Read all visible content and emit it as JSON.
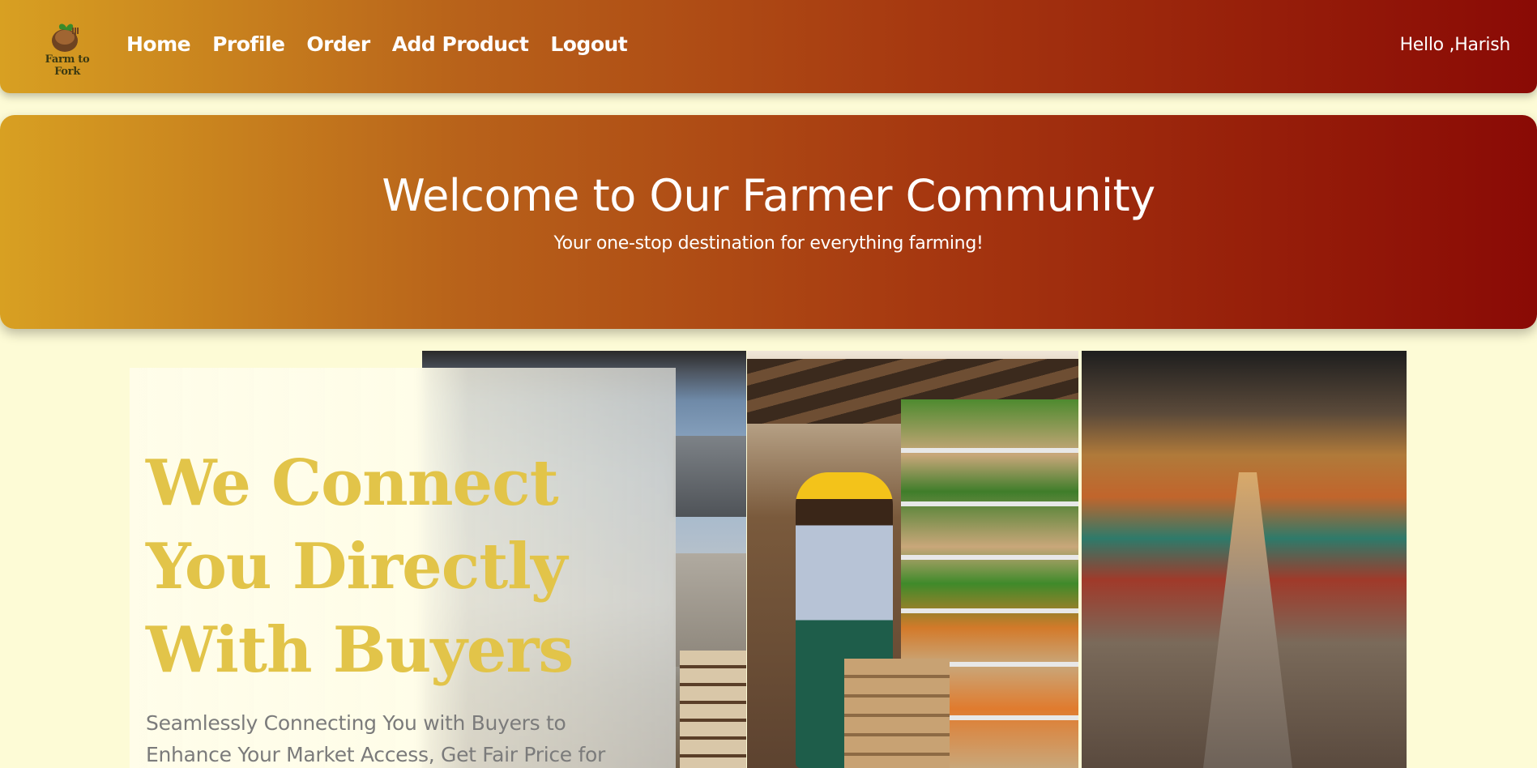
{
  "navbar": {
    "logo_text": "Farm to Fork",
    "links": [
      "Home",
      "Profile",
      "Order",
      "Add Product",
      "Logout"
    ],
    "greeting": "Hello ,Harish"
  },
  "hero": {
    "title": "Welcome to Our Farmer Community",
    "subtitle": "Your one-stop destination for everything farming!"
  },
  "feature": {
    "headline": "We Connect You Directly With Buyers",
    "description": "Seamlessly Connecting You with Buyers to Enhance Your Market Access, Get Fair Price for"
  },
  "colors": {
    "gradient_start": "#d8a022",
    "gradient_end": "#8a0a05",
    "page_background": "#fdfbd6",
    "headline": "#e2c449"
  },
  "icons": [
    "farm-to-fork-logo"
  ]
}
